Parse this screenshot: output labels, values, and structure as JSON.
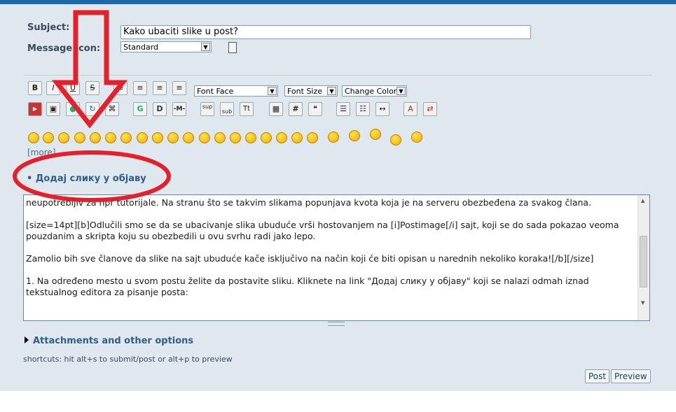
{
  "form": {
    "subject_label": "Subject:",
    "subject_value": "Kako ubaciti slike u post?",
    "icon_label": "Message icon:",
    "icon_value": "Standard"
  },
  "toolbar": {
    "row1": [
      "B",
      "I",
      "U",
      "S"
    ],
    "font_face": "Font Face",
    "font_size": "Font Size",
    "change_color": "Change Color",
    "sup": "sup",
    "sub": "sub",
    "tt": "Tt",
    "hash": "#",
    "g": "G",
    "d": "D",
    "m": "-M-"
  },
  "smilies": {
    "more": "[more]"
  },
  "add_image_link": "• Додај слику у објаву",
  "editor": {
    "line0": "neupotrebljiv za npr tutorijale. Na stranu što se takvim slikama popunjava kvota koja je na serveru obezbeđena za svakog člana.",
    "line1": "[size=14pt][b]Odlučili smo se da se ubacivanje slika ubuduće vrši hostovanjem na [i]Postimage[/i] sajt, koji se do sada pokazao veoma pouzdanim a skripta koju su obezbedili u ovu svrhu radi jako lepo.",
    "line2": "Zamolio bih sve članove da slike na sajt ubuduće kače isključivo na način koji će biti opisan u narednih nekoliko koraka![/b][/size]",
    "line3": "1. Na određeno mesto u svom postu želite da postavite sliku. Kliknete na link \"Додај слику у објаву\" koji se nalazi odmah iznad tekstualnog editora za pisanje posta:"
  },
  "attachments": "Attachments and other options",
  "shortcuts": "shortcuts: hit alt+s to submit/post or alt+p to preview",
  "buttons": {
    "post": "Post",
    "preview": "Preview"
  },
  "colors": {
    "accent": "#1b6aa5",
    "panel": "#dfe7ef",
    "annotation": "#e5202a"
  }
}
